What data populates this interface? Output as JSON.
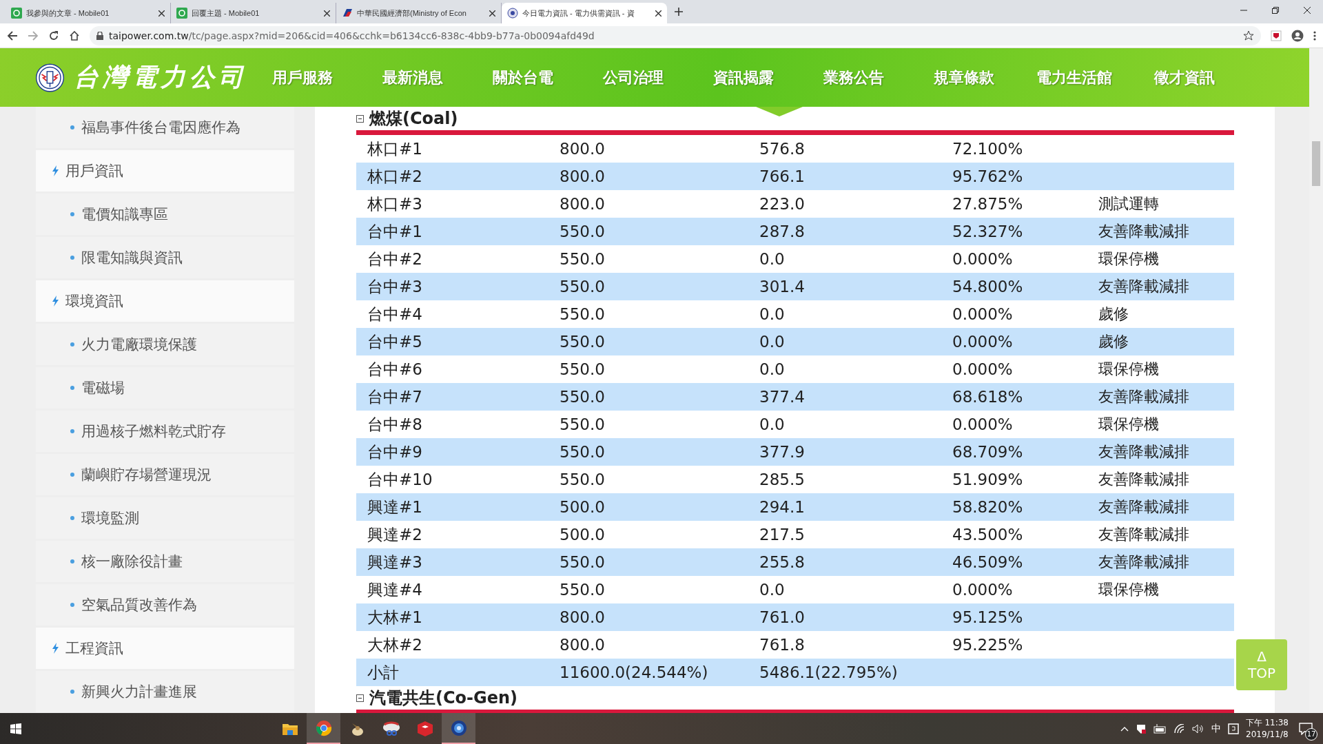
{
  "browser": {
    "tabs": [
      {
        "title": "我參與的文章 - Mobile01",
        "kind": "square",
        "selected": false
      },
      {
        "title": "回覆主題 - Mobile01",
        "kind": "square",
        "selected": false
      },
      {
        "title": "中華民國經濟部(Ministry of Econ",
        "kind": "flag",
        "selected": false
      },
      {
        "title": "今日電力資訊 - 電力供需資訊 - 資",
        "kind": "globe",
        "selected": true
      }
    ],
    "url": {
      "host": "taipower.com.tw",
      "path": "/tc/page.aspx?mid=206&cid=406&cchk=b6134cc6-838c-4bb9-b77a-0b0094afd49d"
    }
  },
  "site": {
    "logo_text": "台灣電力公司",
    "nav": [
      {
        "label": "用戶服務",
        "selected": false
      },
      {
        "label": "最新消息",
        "selected": false
      },
      {
        "label": "關於台電",
        "selected": false
      },
      {
        "label": "公司治理",
        "selected": false
      },
      {
        "label": "資訊揭露",
        "selected": true
      },
      {
        "label": "業務公告",
        "selected": false
      },
      {
        "label": "規章條款",
        "selected": false
      },
      {
        "label": "電力生活館",
        "selected": false
      },
      {
        "label": "徵才資訊",
        "selected": false
      }
    ]
  },
  "sidebar": {
    "items": [
      {
        "kind": "sub",
        "label": "福島事件後台電因應作為"
      },
      {
        "kind": "heading",
        "label": "用戶資訊"
      },
      {
        "kind": "sub",
        "label": "電價知識專區"
      },
      {
        "kind": "sub",
        "label": "限電知識與資訊"
      },
      {
        "kind": "heading",
        "label": "環境資訊"
      },
      {
        "kind": "sub",
        "label": "火力電廠環境保護"
      },
      {
        "kind": "sub",
        "label": "電磁場"
      },
      {
        "kind": "sub",
        "label": "用過核子燃料乾式貯存"
      },
      {
        "kind": "sub",
        "label": "蘭嶼貯存場營運現況"
      },
      {
        "kind": "sub",
        "label": "環境監測"
      },
      {
        "kind": "sub",
        "label": "核一廠除役計畫"
      },
      {
        "kind": "sub",
        "label": "空氣品質改善作為"
      },
      {
        "kind": "heading",
        "label": "工程資訊"
      },
      {
        "kind": "sub",
        "label": "新興火力計畫進展"
      }
    ]
  },
  "sections": [
    {
      "title": "燃煤(Coal)",
      "expanded": true,
      "rows": [
        {
          "kind": "unit",
          "unit": "林口#1",
          "capacity": "800.0",
          "output": "576.8",
          "ratio": "72.100%"
        },
        {
          "kind": "unit",
          "unit": "林口#2",
          "capacity": "800.0",
          "output": "766.1",
          "ratio": "95.762%"
        },
        {
          "kind": "unit",
          "unit": "林口#3",
          "capacity": "800.0",
          "output": "223.0",
          "ratio": "27.875%",
          "note": "測試運轉"
        },
        {
          "kind": "unit",
          "unit": "台中#1",
          "capacity": "550.0",
          "output": "287.8",
          "ratio": "52.327%",
          "note": "友善降載減排"
        },
        {
          "kind": "unit",
          "unit": "台中#2",
          "capacity": "550.0",
          "output": "0.0",
          "ratio": "0.000%",
          "note": "環保停機"
        },
        {
          "kind": "unit",
          "unit": "台中#3",
          "capacity": "550.0",
          "output": "301.4",
          "ratio": "54.800%",
          "note": "友善降載減排"
        },
        {
          "kind": "unit",
          "unit": "台中#4",
          "capacity": "550.0",
          "output": "0.0",
          "ratio": "0.000%",
          "note": "歲修"
        },
        {
          "kind": "unit",
          "unit": "台中#5",
          "capacity": "550.0",
          "output": "0.0",
          "ratio": "0.000%",
          "note": "歲修"
        },
        {
          "kind": "unit",
          "unit": "台中#6",
          "capacity": "550.0",
          "output": "0.0",
          "ratio": "0.000%",
          "note": "環保停機"
        },
        {
          "kind": "unit",
          "unit": "台中#7",
          "capacity": "550.0",
          "output": "377.4",
          "ratio": "68.618%",
          "note": "友善降載減排"
        },
        {
          "kind": "unit",
          "unit": "台中#8",
          "capacity": "550.0",
          "output": "0.0",
          "ratio": "0.000%",
          "note": "環保停機"
        },
        {
          "kind": "unit",
          "unit": "台中#9",
          "capacity": "550.0",
          "output": "377.9",
          "ratio": "68.709%",
          "note": "友善降載減排"
        },
        {
          "kind": "unit",
          "unit": "台中#10",
          "capacity": "550.0",
          "output": "285.5",
          "ratio": "51.909%",
          "note": "友善降載減排"
        },
        {
          "kind": "unit",
          "unit": "興達#1",
          "capacity": "500.0",
          "output": "294.1",
          "ratio": "58.820%",
          "note": "友善降載減排"
        },
        {
          "kind": "unit",
          "unit": "興達#2",
          "capacity": "500.0",
          "output": "217.5",
          "ratio": "43.500%",
          "note": "友善降載減排"
        },
        {
          "kind": "unit",
          "unit": "興達#3",
          "capacity": "550.0",
          "output": "255.8",
          "ratio": "46.509%",
          "note": "友善降載減排"
        },
        {
          "kind": "unit",
          "unit": "興達#4",
          "capacity": "550.0",
          "output": "0.0",
          "ratio": "0.000%",
          "note": "環保停機"
        },
        {
          "kind": "unit",
          "unit": "大林#1",
          "capacity": "800.0",
          "output": "761.0",
          "ratio": "95.125%"
        },
        {
          "kind": "unit",
          "unit": "大林#2",
          "capacity": "800.0",
          "output": "761.8",
          "ratio": "95.225%"
        },
        {
          "kind": "subtotal",
          "unit": "小計",
          "capacity": "11600.0(24.544%)",
          "output": "5486.1(22.795%)"
        }
      ]
    },
    {
      "title": "汽電共生(Co-Gen)",
      "expanded": true
    }
  ],
  "back_to_top": {
    "arrow": "Δ",
    "label": "TOP"
  },
  "taskbar": {
    "apps": [
      {
        "kind": "folder",
        "active": false
      },
      {
        "kind": "chrome",
        "active": true
      },
      {
        "kind": "bird",
        "active": false
      },
      {
        "kind": "tool",
        "active": false
      },
      {
        "kind": "cube",
        "active": false
      },
      {
        "kind": "orb",
        "active": true
      }
    ],
    "ime": "中",
    "time": "下午 11:38",
    "date": "2019/11/8",
    "notifications": "17"
  }
}
